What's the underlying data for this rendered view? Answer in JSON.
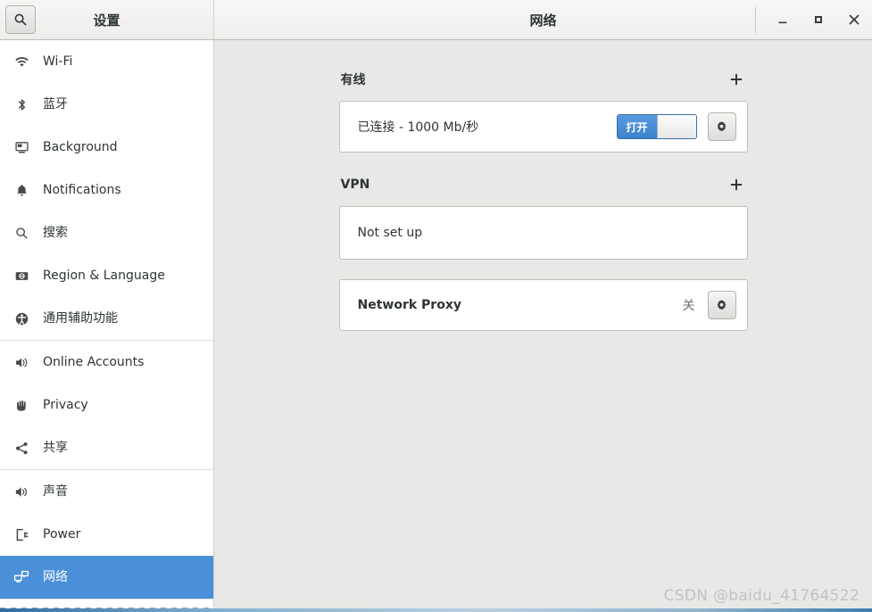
{
  "window": {
    "settings_title": "设置",
    "page_title": "网络",
    "search_icon": "search-icon",
    "minimize_label": "_",
    "maximize_label": "□",
    "close_label": "×"
  },
  "colors": {
    "accent_blue": "#4a90d9",
    "switch_blue": "#3c82cd",
    "window_bg": "#e8e8e7",
    "sidebar_bg": "#ffffff",
    "card_bg": "#ffffff",
    "card_border": "#c3c0bb",
    "text": "#2e3436",
    "watermark": "#c2c2c0"
  },
  "sidebar": {
    "groups": [
      {
        "items": [
          {
            "label": "Wi-Fi",
            "icon": "wifi-icon",
            "selected": false
          },
          {
            "label": "蓝牙",
            "icon": "bluetooth-icon",
            "selected": false
          },
          {
            "label": "Background",
            "icon": "monitor-icon",
            "selected": false
          },
          {
            "label": "Notifications",
            "icon": "bell-icon",
            "selected": false
          },
          {
            "label": "搜索",
            "icon": "search-icon",
            "selected": false
          },
          {
            "label": "Region & Language",
            "icon": "region-icon",
            "selected": false
          },
          {
            "label": "通用辅助功能",
            "icon": "accessibility-icon",
            "selected": false
          }
        ]
      },
      {
        "items": [
          {
            "label": "Online Accounts",
            "icon": "online-accounts-icon",
            "selected": false
          },
          {
            "label": "Privacy",
            "icon": "hand-icon",
            "selected": false
          },
          {
            "label": "共享",
            "icon": "share-icon",
            "selected": false
          }
        ]
      },
      {
        "items": [
          {
            "label": "声音",
            "icon": "speaker-icon",
            "selected": false
          },
          {
            "label": "Power",
            "icon": "power-icon",
            "selected": false
          },
          {
            "label": "网络",
            "icon": "network-icon",
            "selected": true
          }
        ]
      }
    ]
  },
  "main": {
    "wired": {
      "section_title": "有线",
      "add_label": "+",
      "status_text": "已连接 - 1000 Mb/秒",
      "switch_on_label": "打开",
      "settings_icon": "gear-icon"
    },
    "vpn": {
      "section_title": "VPN",
      "add_label": "+",
      "status_text": "Not set up"
    },
    "proxy": {
      "label": "Network Proxy",
      "status": "关",
      "settings_icon": "gear-icon"
    }
  },
  "watermark": {
    "text": "CSDN @baidu_41764522"
  }
}
